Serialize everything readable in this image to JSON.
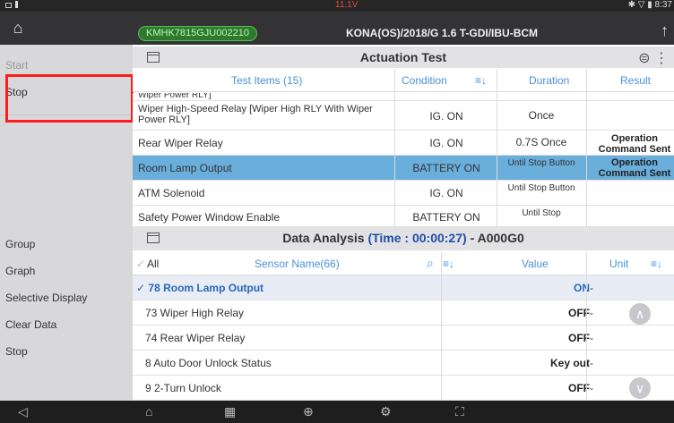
{
  "status_bar": {
    "voltage": "11.1V",
    "time": "8:37"
  },
  "header": {
    "vin": "KMHK7815GJU002210",
    "vehicle": "KONA(OS)/2018/G 1.6 T-GDI/IBU-BCM"
  },
  "sidebar": {
    "top_items": [
      {
        "label": "Start"
      },
      {
        "label": "Stop"
      }
    ],
    "bottom_items": [
      {
        "label": "Group"
      },
      {
        "label": "Graph"
      },
      {
        "label": "Selective Display"
      },
      {
        "label": "Clear Data"
      },
      {
        "label": "Stop"
      }
    ]
  },
  "actuation": {
    "title": "Actuation Test",
    "columns": {
      "items": "Test Items (15)",
      "condition": "Condition",
      "duration": "Duration",
      "result": "Result"
    },
    "rows": [
      {
        "item": "Wiper Power RLY]",
        "condition": "",
        "duration": "",
        "result": ""
      },
      {
        "item": "Wiper High-Speed Relay [Wiper High RLY With Wiper Power RLY]",
        "condition": "IG. ON",
        "duration": "Once",
        "result": ""
      },
      {
        "item": "Rear Wiper Relay",
        "condition": "IG. ON",
        "duration": "0.7S Once",
        "result": "Operation Command Sent"
      },
      {
        "item": "Room Lamp Output",
        "condition": "BATTERY ON",
        "duration": "Until Stop Button",
        "result": "Operation Command Sent"
      },
      {
        "item": "ATM Solenoid",
        "condition": "IG. ON",
        "duration": "Until Stop Button",
        "result": ""
      },
      {
        "item": "Safety Power Window Enable",
        "condition": "BATTERY ON",
        "duration": "Until Stop",
        "result": ""
      }
    ]
  },
  "data_analysis": {
    "title_prefix": "Data Analysis",
    "time": "(Time : 00:00:27)",
    "code": "- A000G0",
    "columns": {
      "all": "All",
      "sensor": "Sensor Name(66)",
      "value": "Value",
      "unit": "Unit"
    },
    "rows": [
      {
        "name": "78 Room Lamp Output",
        "value": "ON",
        "unit": "-"
      },
      {
        "name": "73 Wiper High Relay",
        "value": "OFF",
        "unit": "-"
      },
      {
        "name": "74 Rear Wiper Relay",
        "value": "OFF",
        "unit": "-"
      },
      {
        "name": "8 Auto Door Unlock Status",
        "value": "Key out",
        "unit": "-"
      },
      {
        "name": "9 2-Turn Unlock",
        "value": "OFF",
        "unit": "-"
      }
    ]
  },
  "colors": {
    "highlight": "#ff1b1b",
    "selected_row": "#6aaedb",
    "accent": "#4a90d9"
  }
}
